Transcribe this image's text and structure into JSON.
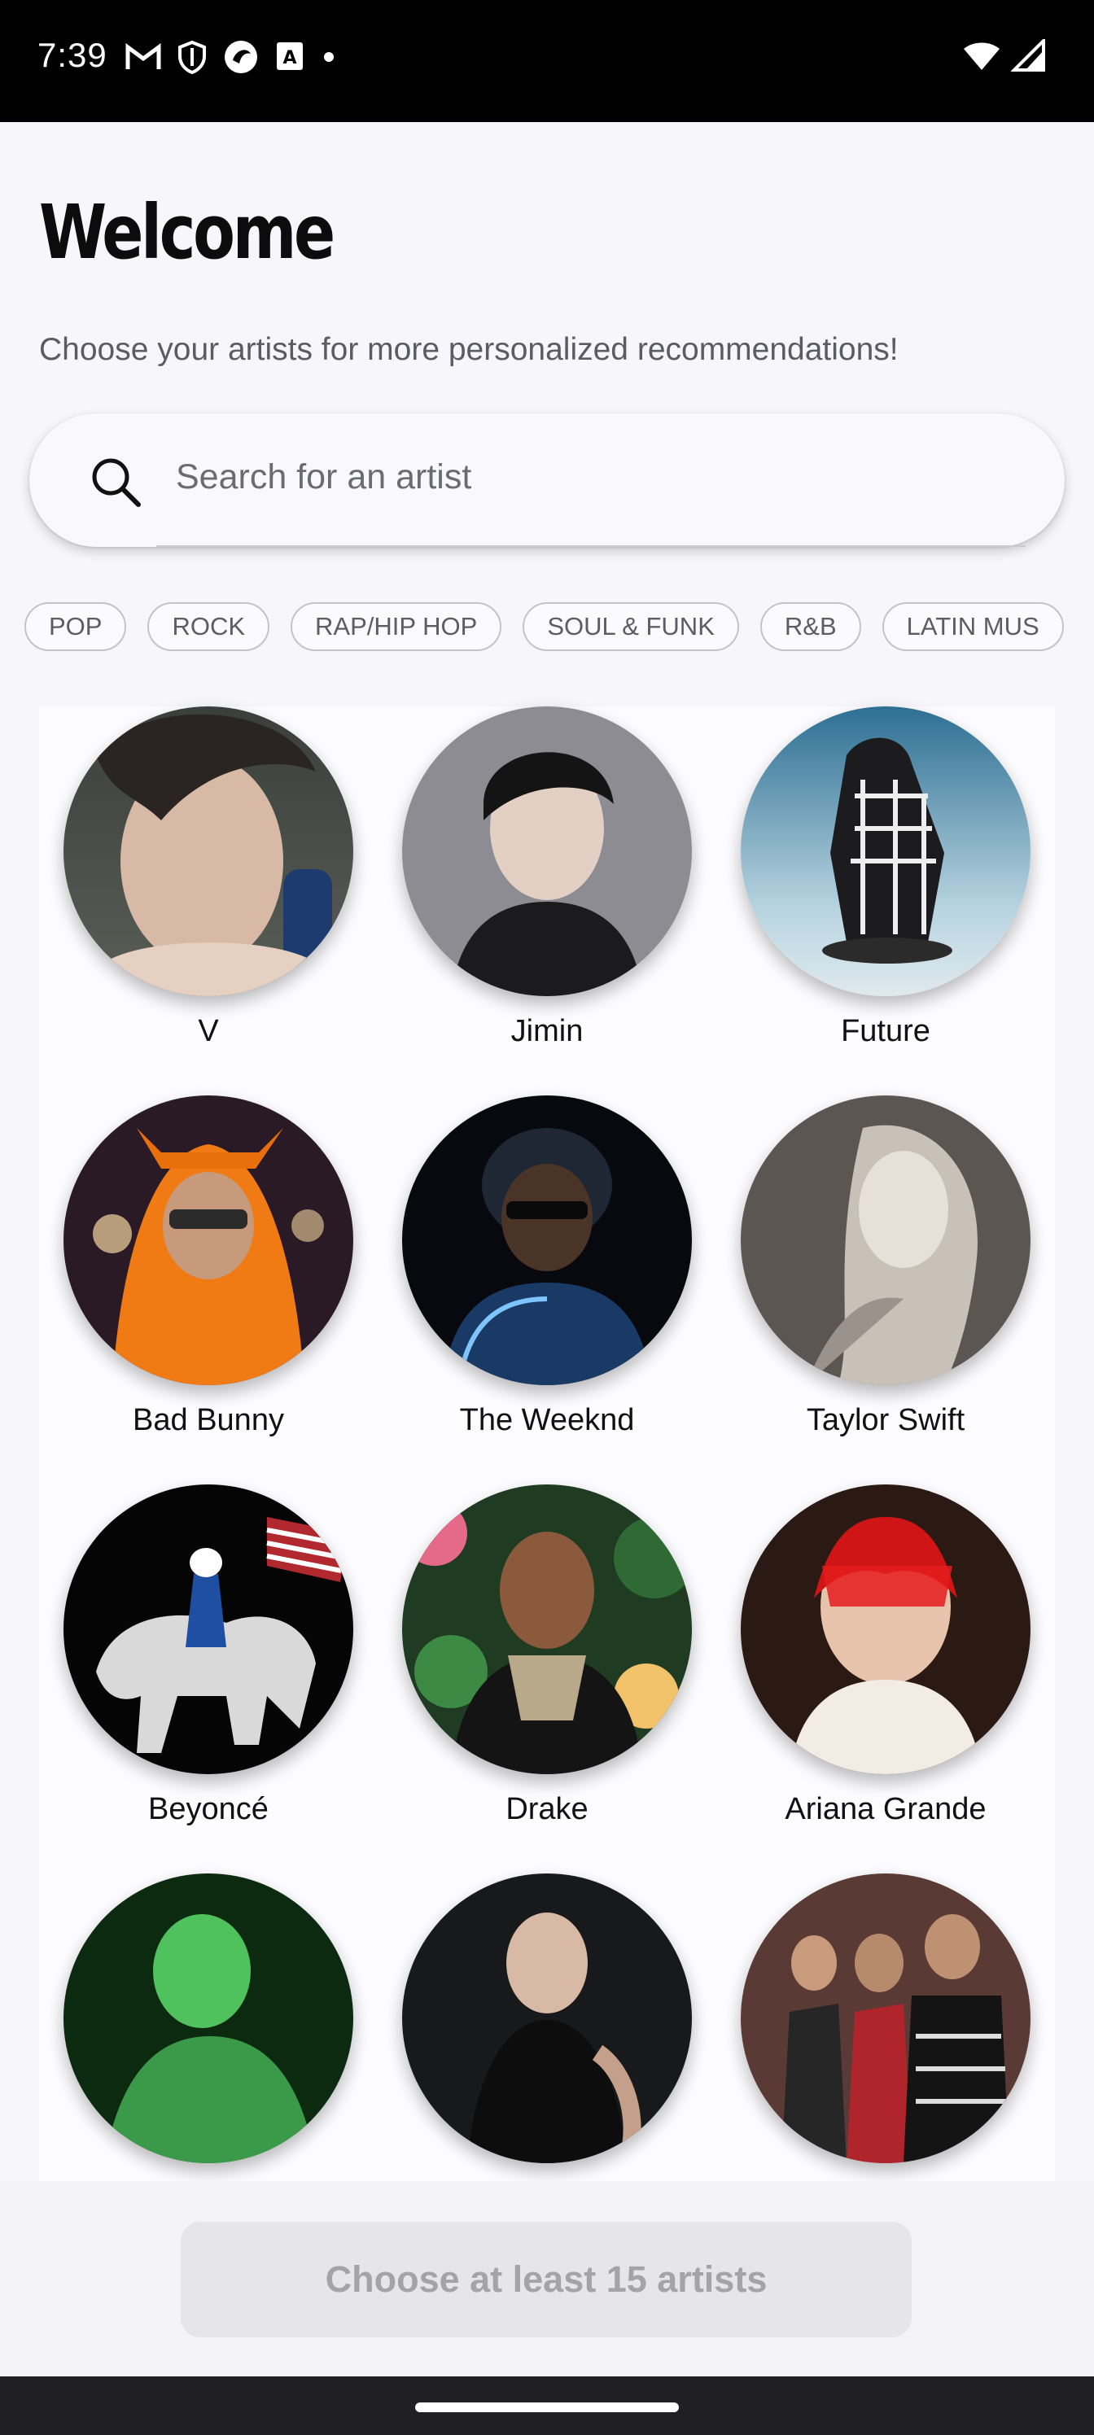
{
  "status_bar": {
    "time": "7:39",
    "icons": [
      "gmail-icon",
      "shield-icon",
      "app-icon",
      "text-icon",
      "dot-icon",
      "wifi-icon",
      "signal-icon"
    ]
  },
  "header": {
    "title": "Welcome",
    "subtitle": "Choose your artists for more personalized recommendations!"
  },
  "search": {
    "placeholder": "Search for an artist"
  },
  "genres": [
    "POP",
    "ROCK",
    "RAP/HIP HOP",
    "SOUL & FUNK",
    "R&B",
    "LATIN MUS"
  ],
  "artists": [
    {
      "name": "V"
    },
    {
      "name": "Jimin"
    },
    {
      "name": "Future"
    },
    {
      "name": "Bad Bunny"
    },
    {
      "name": "The Weeknd"
    },
    {
      "name": "Taylor Swift"
    },
    {
      "name": "Beyoncé"
    },
    {
      "name": "Drake"
    },
    {
      "name": "Ariana Grande"
    },
    {
      "name": ""
    },
    {
      "name": ""
    },
    {
      "name": ""
    }
  ],
  "cta": {
    "label": "Choose at least 15 artists"
  },
  "colors": {
    "background": "#f7f7fb",
    "cta_background": "#e6e6ea",
    "cta_text": "#a3a3a8",
    "chip_border": "#c4c4c8"
  }
}
